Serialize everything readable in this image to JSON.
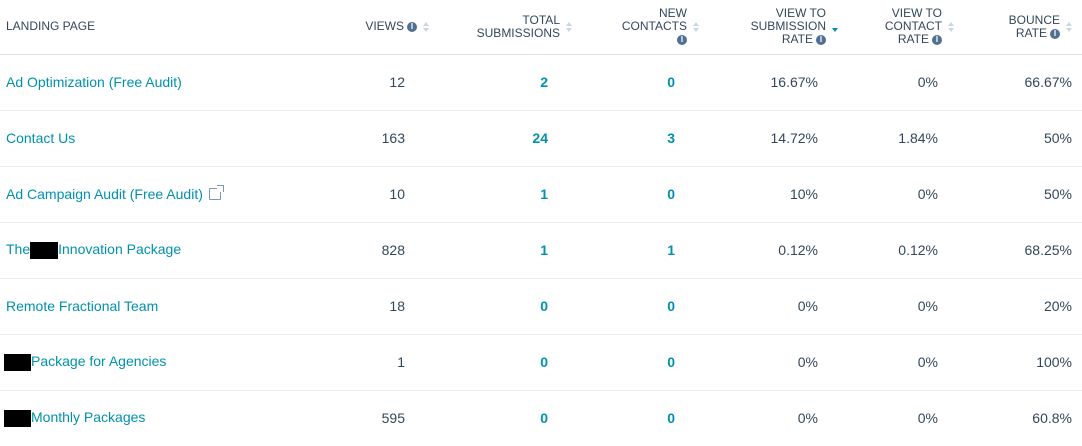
{
  "table": {
    "columns": {
      "landing_page": "LANDING PAGE",
      "views": "VIEWS",
      "total_submissions_1": "TOTAL",
      "total_submissions_2": "SUBMISSIONS",
      "new_contacts_1": "NEW",
      "new_contacts_2": "CONTACTS",
      "view_to_submission_1": "VIEW TO",
      "view_to_submission_2": "SUBMISSION",
      "view_to_submission_3": "RATE",
      "view_to_contact_1": "VIEW TO",
      "view_to_contact_2": "CONTACT",
      "view_to_contact_3": "RATE",
      "bounce_1": "BOUNCE",
      "bounce_2": "RATE"
    },
    "info_glyph": "i",
    "rows": [
      {
        "name_prefix": "Ad Optimization (Free Audit)",
        "name_suffix": "",
        "views": "12",
        "submissions": "2",
        "contacts": "0",
        "view_sub_rate": "16.67%",
        "view_contact_rate": "0%",
        "bounce_rate": "66.67%"
      },
      {
        "name_prefix": "Contact Us",
        "name_suffix": "",
        "views": "163",
        "submissions": "24",
        "contacts": "3",
        "view_sub_rate": "14.72%",
        "view_contact_rate": "1.84%",
        "bounce_rate": "50%"
      },
      {
        "name_prefix": "Ad Campaign Audit (Free Audit)",
        "name_suffix": "",
        "views": "10",
        "submissions": "1",
        "contacts": "0",
        "view_sub_rate": "10%",
        "view_contact_rate": "0%",
        "bounce_rate": "50%"
      },
      {
        "name_prefix": "The",
        "name_suffix": "Innovation Package",
        "views": "828",
        "submissions": "1",
        "contacts": "1",
        "view_sub_rate": "0.12%",
        "view_contact_rate": "0.12%",
        "bounce_rate": "68.25%"
      },
      {
        "name_prefix": "Remote Fractional Team",
        "name_suffix": "",
        "views": "18",
        "submissions": "0",
        "contacts": "0",
        "view_sub_rate": "0%",
        "view_contact_rate": "0%",
        "bounce_rate": "20%"
      },
      {
        "name_prefix": "",
        "name_suffix": "Package for Agencies",
        "views": "1",
        "submissions": "0",
        "contacts": "0",
        "view_sub_rate": "0%",
        "view_contact_rate": "0%",
        "bounce_rate": "100%"
      },
      {
        "name_prefix": "",
        "name_suffix": "Monthly Packages",
        "views": "595",
        "submissions": "0",
        "contacts": "0",
        "view_sub_rate": "0%",
        "view_contact_rate": "0%",
        "bounce_rate": "60.8%"
      }
    ]
  },
  "colors": {
    "link": "#0091ae",
    "text": "#33475b",
    "sort_active": "#0091ae"
  }
}
